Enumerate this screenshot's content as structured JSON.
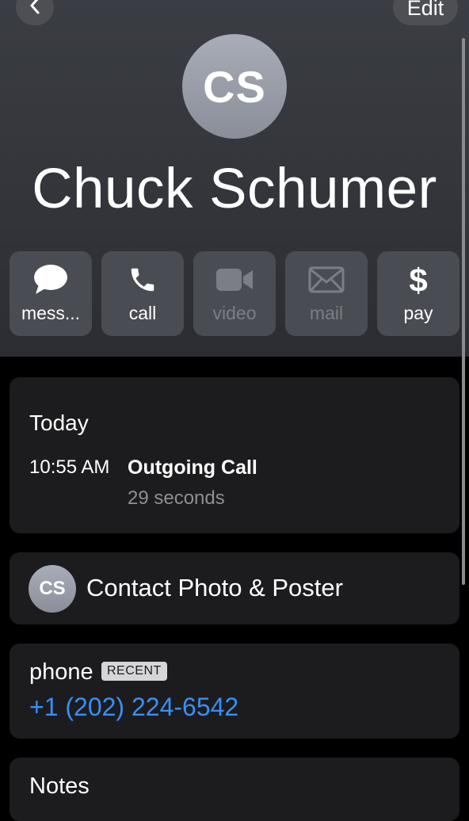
{
  "nav": {
    "edit_label": "Edit",
    "back_icon": "chevron-left-icon"
  },
  "contact": {
    "initials": "CS",
    "name": "Chuck Schumer"
  },
  "actions": [
    {
      "label": "mess...",
      "icon": "message-bubble-icon",
      "enabled": true
    },
    {
      "label": "call",
      "icon": "phone-icon",
      "enabled": true
    },
    {
      "label": "video",
      "icon": "video-camera-icon",
      "enabled": false
    },
    {
      "label": "mail",
      "icon": "envelope-icon",
      "enabled": false
    },
    {
      "label": "pay",
      "icon": "dollar-icon",
      "enabled": true
    }
  ],
  "history": {
    "title": "Today",
    "entries": [
      {
        "time": "10:55 AM",
        "type": "Outgoing Call",
        "duration": "29 seconds"
      }
    ]
  },
  "poster": {
    "initials": "CS",
    "label": "Contact Photo & Poster"
  },
  "phone": {
    "label": "phone",
    "badge": "RECENT",
    "number": "+1 (202) 224-6542"
  },
  "notes": {
    "label": "Notes"
  },
  "colors": {
    "link": "#3a8ef6",
    "card_bg": "#1c1c1e",
    "button_bg": "#4a4c53",
    "disabled_text": "#7c7e85"
  }
}
